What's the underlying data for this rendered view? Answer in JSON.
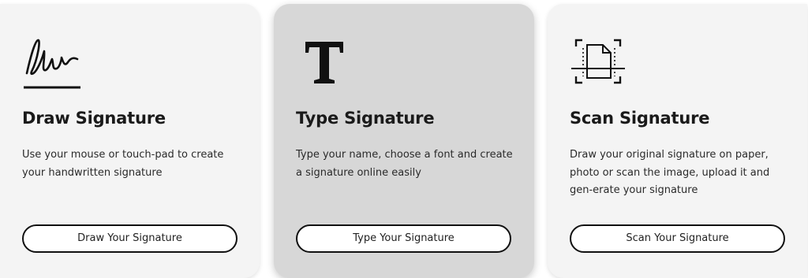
{
  "cards": [
    {
      "id": "draw",
      "icon": "handwriting-signature-icon",
      "title": "Draw Signature",
      "description": "Use your mouse or touch-pad to create your handwritten signature",
      "button_label": "Draw Your Signature"
    },
    {
      "id": "type",
      "icon": "text-type-icon",
      "title": "Type Signature",
      "description": "Type your name, choose a font and create a signature online easily",
      "button_label": "Type Your Signature"
    },
    {
      "id": "scan",
      "icon": "document-scan-icon",
      "title": "Scan Signature",
      "description": "Draw your original signature on paper, photo or scan the image, upload it and gen-erate your signature",
      "button_label": "Scan Your Signature"
    }
  ],
  "colors": {
    "card_background": "#f4f4f4",
    "card_background_active": "#d7d7d7",
    "button_border": "#111111",
    "text": "#1a1a1a"
  }
}
